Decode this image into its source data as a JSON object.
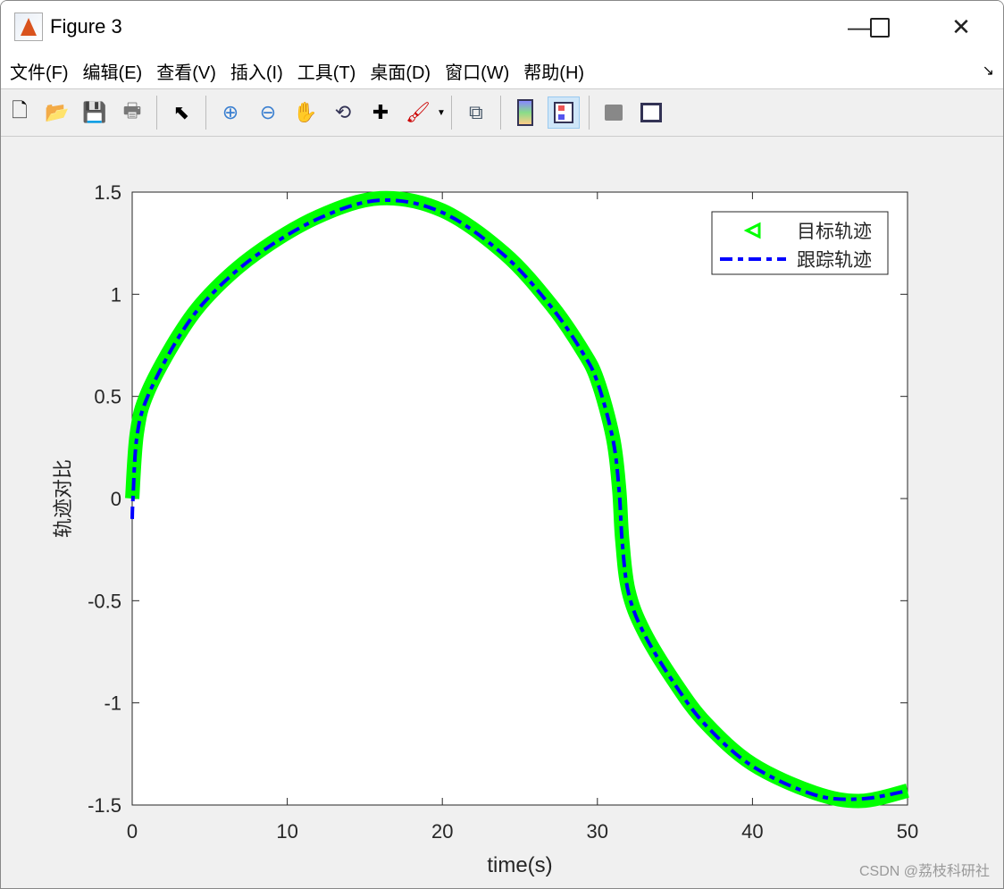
{
  "window": {
    "title": "Figure 3"
  },
  "menu": [
    "文件(F)",
    "编辑(E)",
    "查看(V)",
    "插入(I)",
    "工具(T)",
    "桌面(D)",
    "窗口(W)",
    "帮助(H)"
  ],
  "toolbar": [
    "new-file",
    "open-file",
    "save",
    "print",
    "pointer",
    "zoom-in",
    "zoom-out",
    "pan",
    "rotate-3d",
    "data-cursor",
    "brush",
    "link-plot",
    "colorbar",
    "legend",
    "hide-plot-tools",
    "show-plot-tools"
  ],
  "watermark": "CSDN @荔枝科研社",
  "chart_data": {
    "type": "line",
    "xlabel": "time(s)",
    "ylabel": "轨迹对比",
    "xlim": [
      0,
      50
    ],
    "ylim": [
      -1.5,
      1.5
    ],
    "xticks": [
      "0",
      "10",
      "20",
      "30",
      "40",
      "50"
    ],
    "yticks": [
      "1.5",
      "1",
      "0.5",
      "0",
      "-0.5",
      "-1",
      "-1.5"
    ],
    "legend": {
      "position": "top-right",
      "entries": [
        "目标轨迹",
        "跟踪轨迹"
      ]
    },
    "series": [
      {
        "name": "目标轨迹",
        "color": "#00ff00",
        "marker": "triangle-left",
        "x": [
          0,
          0.3,
          1,
          3,
          5,
          8,
          12,
          16,
          20,
          24,
          27,
          29,
          30,
          31,
          31.4,
          31.6,
          32,
          33,
          35,
          37,
          40,
          44,
          47,
          50
        ],
        "y": [
          0,
          0.32,
          0.52,
          0.8,
          1.0,
          1.2,
          1.38,
          1.47,
          1.41,
          1.2,
          0.95,
          0.73,
          0.58,
          0.3,
          0.05,
          -0.2,
          -0.45,
          -0.65,
          -0.9,
          -1.1,
          -1.3,
          -1.44,
          -1.48,
          -1.43
        ]
      },
      {
        "name": "跟踪轨迹",
        "color": "#0000ff",
        "style": "dash-dot",
        "x": [
          0,
          0.05,
          0.3,
          1,
          3,
          5,
          8,
          12,
          16,
          20,
          24,
          27,
          29,
          30,
          31,
          31.4,
          31.6,
          32,
          33,
          35,
          37,
          40,
          44,
          47,
          50
        ],
        "y": [
          -0.1,
          0,
          0.3,
          0.5,
          0.79,
          0.99,
          1.19,
          1.37,
          1.46,
          1.4,
          1.19,
          0.94,
          0.72,
          0.57,
          0.29,
          0.04,
          -0.21,
          -0.46,
          -0.66,
          -0.91,
          -1.11,
          -1.31,
          -1.45,
          -1.47,
          -1.43
        ]
      }
    ]
  }
}
